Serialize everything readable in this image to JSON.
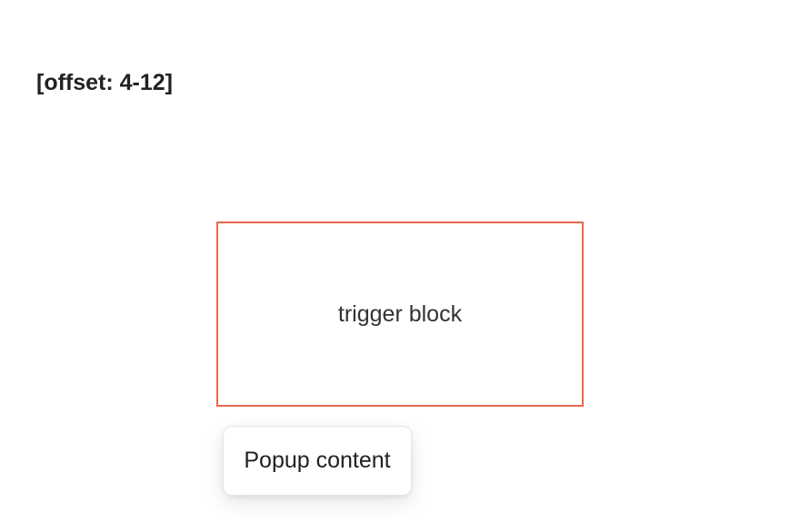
{
  "heading": {
    "text": "[offset: 4-12]"
  },
  "trigger": {
    "label": "trigger block",
    "border_color": "#e8664f"
  },
  "popup": {
    "content": "Popup content"
  }
}
